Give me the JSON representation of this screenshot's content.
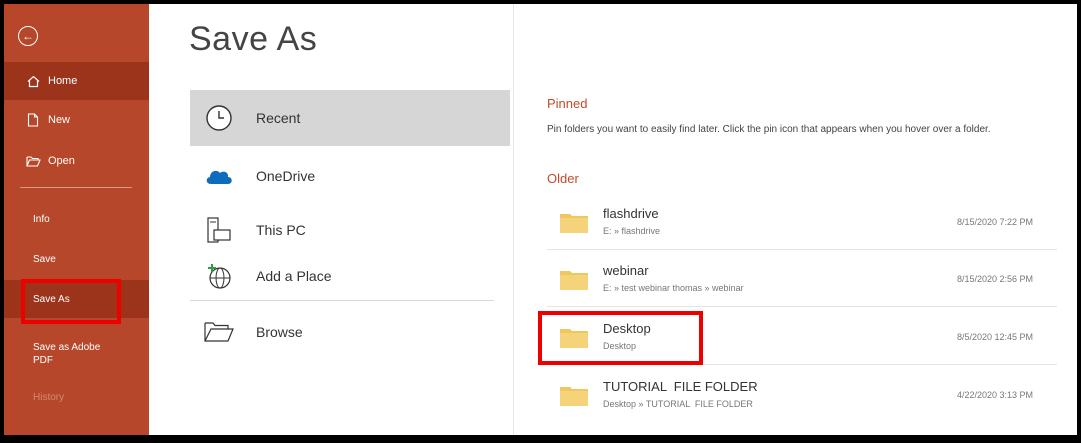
{
  "sidebar": {
    "back_icon": "back-arrow-icon",
    "items": [
      {
        "label": "Home",
        "icon": "home-icon"
      },
      {
        "label": "New",
        "icon": "new-doc-icon"
      },
      {
        "label": "Open",
        "icon": "folder-open-icon"
      }
    ],
    "sub_items": [
      {
        "label": "Info"
      },
      {
        "label": "Save"
      },
      {
        "label": "Save As"
      },
      {
        "label": "Save as Adobe PDF"
      },
      {
        "label": "History"
      }
    ]
  },
  "page": {
    "title": "Save As"
  },
  "locations": [
    {
      "label": "Recent",
      "icon": "clock-icon"
    },
    {
      "label": "OneDrive",
      "icon": "cloud-icon"
    },
    {
      "label": "This PC",
      "icon": "pc-icon"
    },
    {
      "label": "Add a Place",
      "icon": "add-place-icon"
    },
    {
      "label": "Browse",
      "icon": "folder-open-icon"
    }
  ],
  "pinned": {
    "heading": "Pinned",
    "description": "Pin folders you want to easily find later. Click the pin icon that appears when you hover over a folder."
  },
  "older": {
    "heading": "Older",
    "folders": [
      {
        "name": "flashdrive",
        "path": "E: » flashdrive",
        "date": "8/15/2020 7:22 PM"
      },
      {
        "name": "webinar",
        "path": "E: » test webinar thomas » webinar",
        "date": "8/15/2020 2:56 PM"
      },
      {
        "name": "Desktop",
        "path": "Desktop",
        "date": "8/5/2020 12:45 PM"
      },
      {
        "name": "TUTORIAL  FILE FOLDER",
        "path": "Desktop » TUTORIAL  FILE FOLDER",
        "date": "4/22/2020 3:13 PM"
      }
    ]
  },
  "colors": {
    "sidebar": "#b7472a",
    "sidebar_selected": "#9c341c",
    "accent_text": "#c44a2a",
    "folder": "#f0c75e",
    "highlight_box": "#e00000"
  }
}
